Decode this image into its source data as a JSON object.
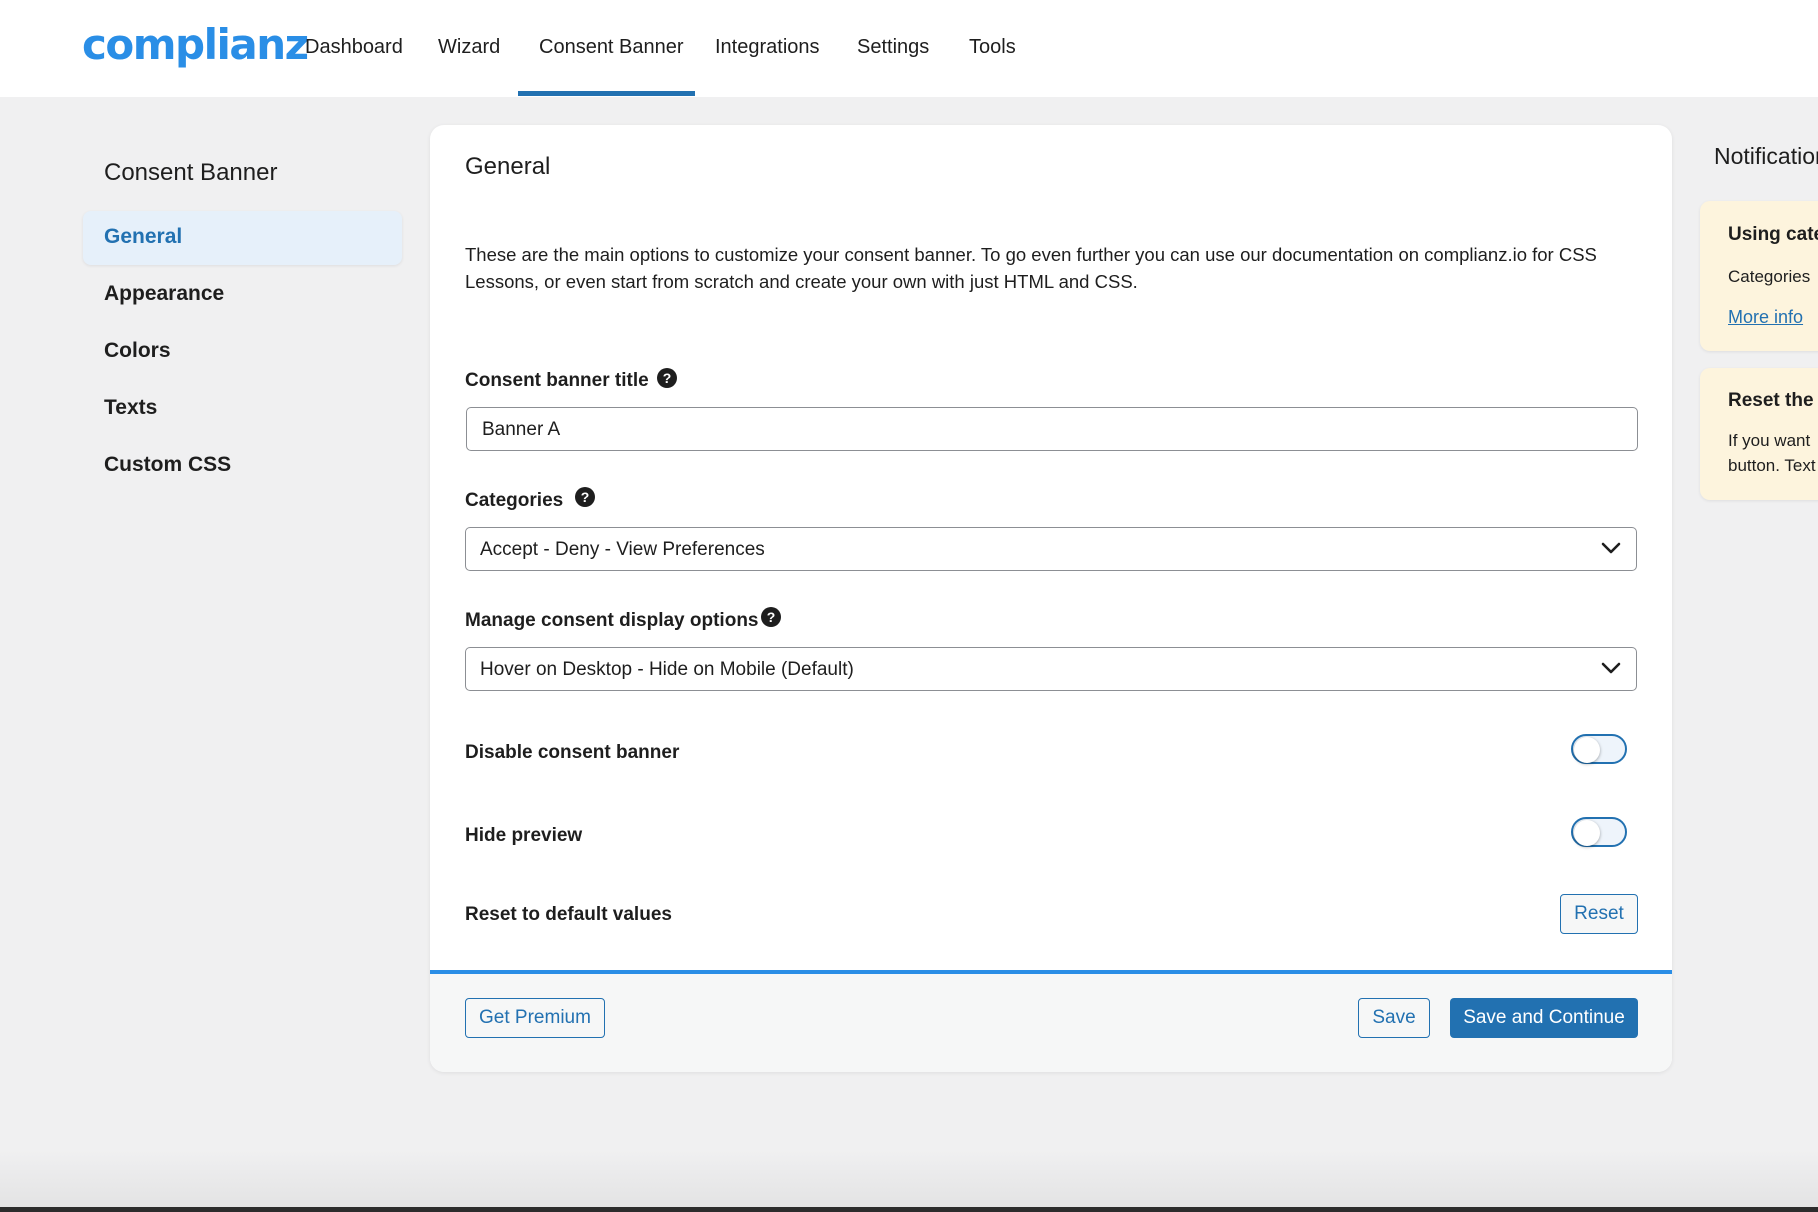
{
  "brand": {
    "logo_text": "complianz",
    "accent_color": "#2271b1",
    "logo_color": "#2a8ee6"
  },
  "nav": {
    "items": [
      {
        "label": "Dashboard"
      },
      {
        "label": "Wizard"
      },
      {
        "label": "Consent Banner",
        "active": true
      },
      {
        "label": "Integrations"
      },
      {
        "label": "Settings"
      },
      {
        "label": "Tools"
      }
    ]
  },
  "sidebar": {
    "title": "Consent Banner",
    "items": [
      {
        "label": "General",
        "active": true
      },
      {
        "label": "Appearance"
      },
      {
        "label": "Colors"
      },
      {
        "label": "Texts"
      },
      {
        "label": "Custom CSS"
      }
    ]
  },
  "main": {
    "title": "General",
    "description": "These are the main options to customize your consent banner. To go even further you can use our documentation on complianz.io for CSS Lessons, or even start from scratch and create your own with just HTML and CSS.",
    "fields": {
      "banner_title": {
        "label": "Consent banner title",
        "value": "Banner A",
        "help_icon": "question-circle-icon"
      },
      "categories": {
        "label": "Categories",
        "value": "Accept - Deny - View Preferences",
        "help_icon": "question-circle-icon"
      },
      "display_options": {
        "label": "Manage consent display options",
        "value": "Hover on Desktop - Hide on Mobile (Default)",
        "help_icon": "question-circle-icon"
      },
      "disable_banner": {
        "label": "Disable consent banner",
        "checked": false
      },
      "hide_preview": {
        "label": "Hide preview",
        "checked": false
      },
      "reset": {
        "label": "Reset to default values",
        "button": "Reset"
      }
    },
    "help_glyph": "?",
    "footer": {
      "get_premium": "Get Premium",
      "save": "Save",
      "save_continue": "Save and Continue"
    }
  },
  "notifications": {
    "title": "Notifications",
    "cards": [
      {
        "title": "Using categories",
        "body": "Categories",
        "link": "More info"
      },
      {
        "title": "Reset the",
        "body_lines": [
          "If you want",
          "button. Text"
        ]
      }
    ]
  }
}
